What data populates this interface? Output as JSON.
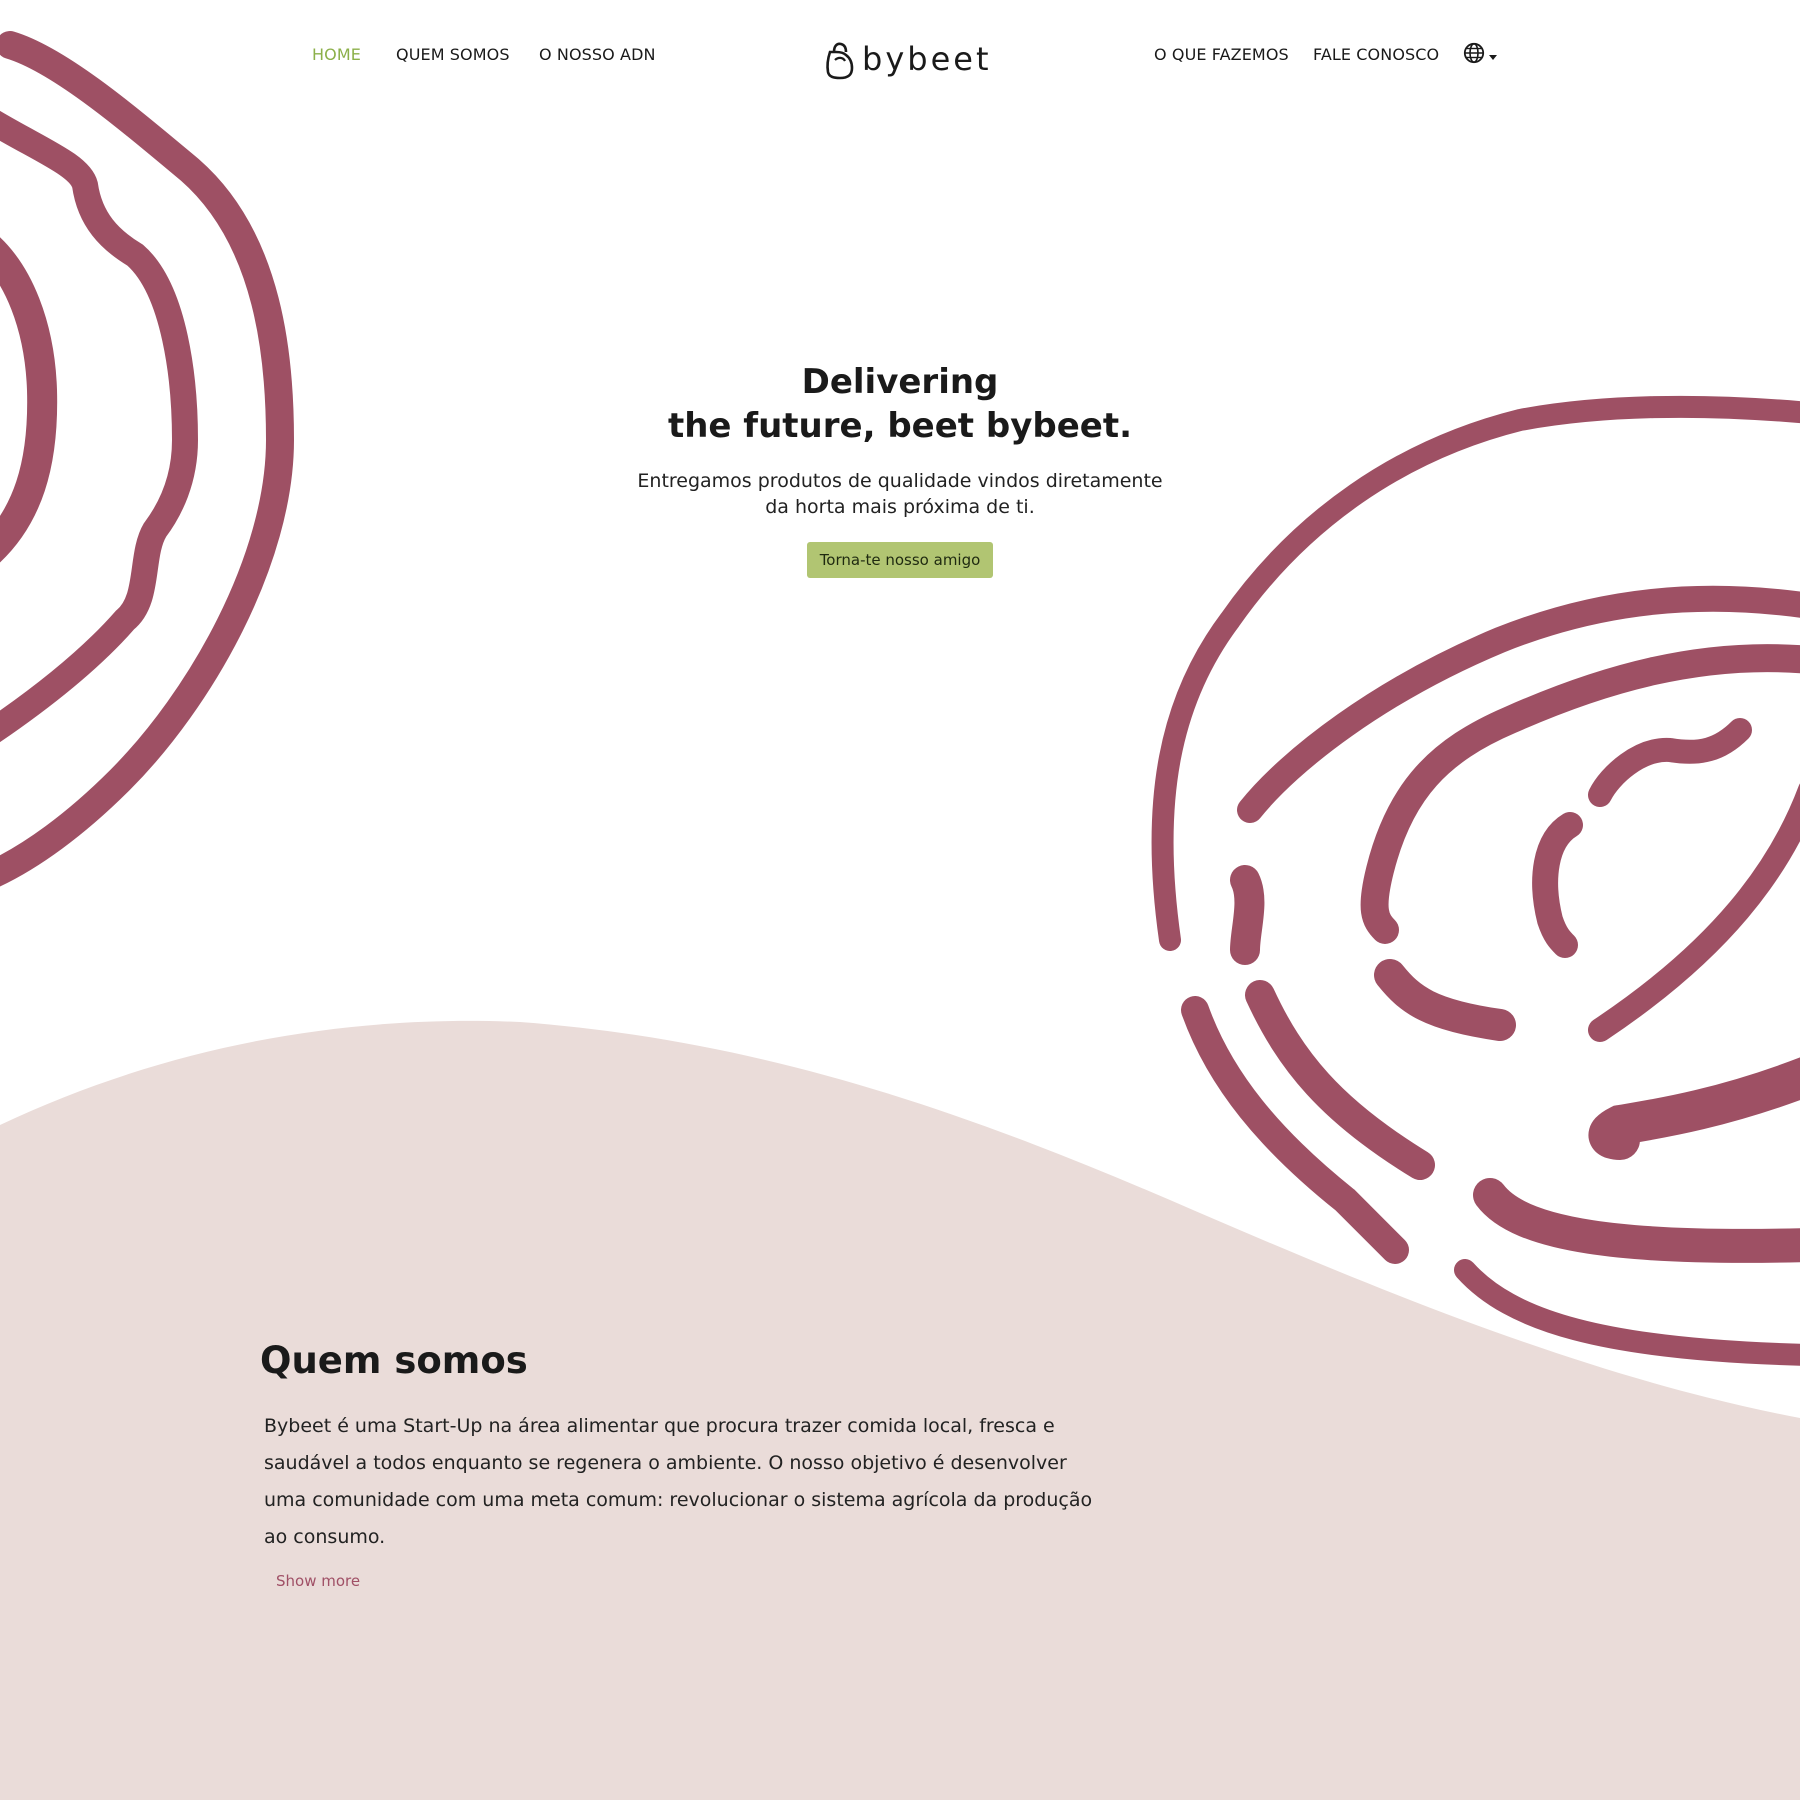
{
  "colors": {
    "accent_green": "#8cb04a",
    "button_green": "#b1c572",
    "beet_maroon": "#9e5064",
    "section_pink": "#eadcd9",
    "link_rose": "#a05066"
  },
  "nav": {
    "left_items": [
      {
        "label": "HOME",
        "active": true
      },
      {
        "label": "QUEM SOMOS",
        "active": false
      },
      {
        "label": "O NOSSO ADN",
        "active": false
      }
    ],
    "logo_text": "bybeet",
    "logo_icon": "beet-bag-icon",
    "right_items": [
      {
        "label": "O QUE FAZEMOS"
      },
      {
        "label": "FALE CONOSCO"
      }
    ],
    "language_icon": "globe-icon"
  },
  "hero": {
    "title_line1": "Delivering",
    "title_line2": "the future, beet bybeet.",
    "subtitle_line1": "Entregamos produtos de qualidade vindos diretamente",
    "subtitle_line2": "da horta mais próxima de ti.",
    "cta_label": "Torna-te nosso amigo"
  },
  "about": {
    "title": "Quem somos",
    "body": "Bybeet é uma Start-Up na área alimentar que procura trazer comida local, fresca e saudável a todos enquanto se regenera o ambiente. O nosso objetivo é desenvolver uma comunidade com uma meta comum: revolucionar o sistema agrícola da produção ao consumo.",
    "show_more_label": "Show more"
  }
}
